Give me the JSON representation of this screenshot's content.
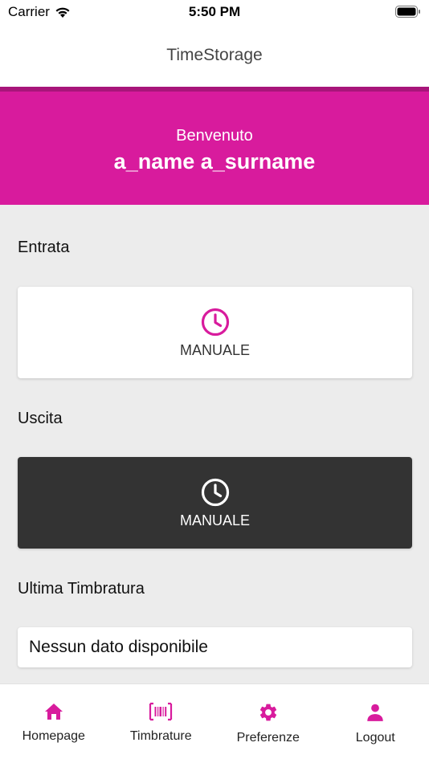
{
  "status_bar": {
    "carrier": "Carrier",
    "time": "5:50 PM"
  },
  "nav": {
    "title": "TimeStorage"
  },
  "hero": {
    "greeting": "Benvenuto",
    "username": "a_name a_surname"
  },
  "entrata": {
    "title": "Entrata",
    "button_label": "MANUALE",
    "icon": "clock-icon"
  },
  "uscita": {
    "title": "Uscita",
    "button_label": "MANUALE",
    "icon": "clock-icon"
  },
  "ultima": {
    "title": "Ultima Timbratura",
    "value": "Nessun dato disponibile"
  },
  "tabs": [
    {
      "label": "Homepage",
      "icon": "home-icon"
    },
    {
      "label": "Timbrature",
      "icon": "barcode-icon"
    },
    {
      "label": "Preferenze",
      "icon": "gear-icon"
    },
    {
      "label": "Logout",
      "icon": "person-icon"
    }
  ],
  "colors": {
    "accent": "#d81b9d",
    "accent_dark": "#a8157a",
    "dark_button": "#333333",
    "background": "#ececec"
  }
}
